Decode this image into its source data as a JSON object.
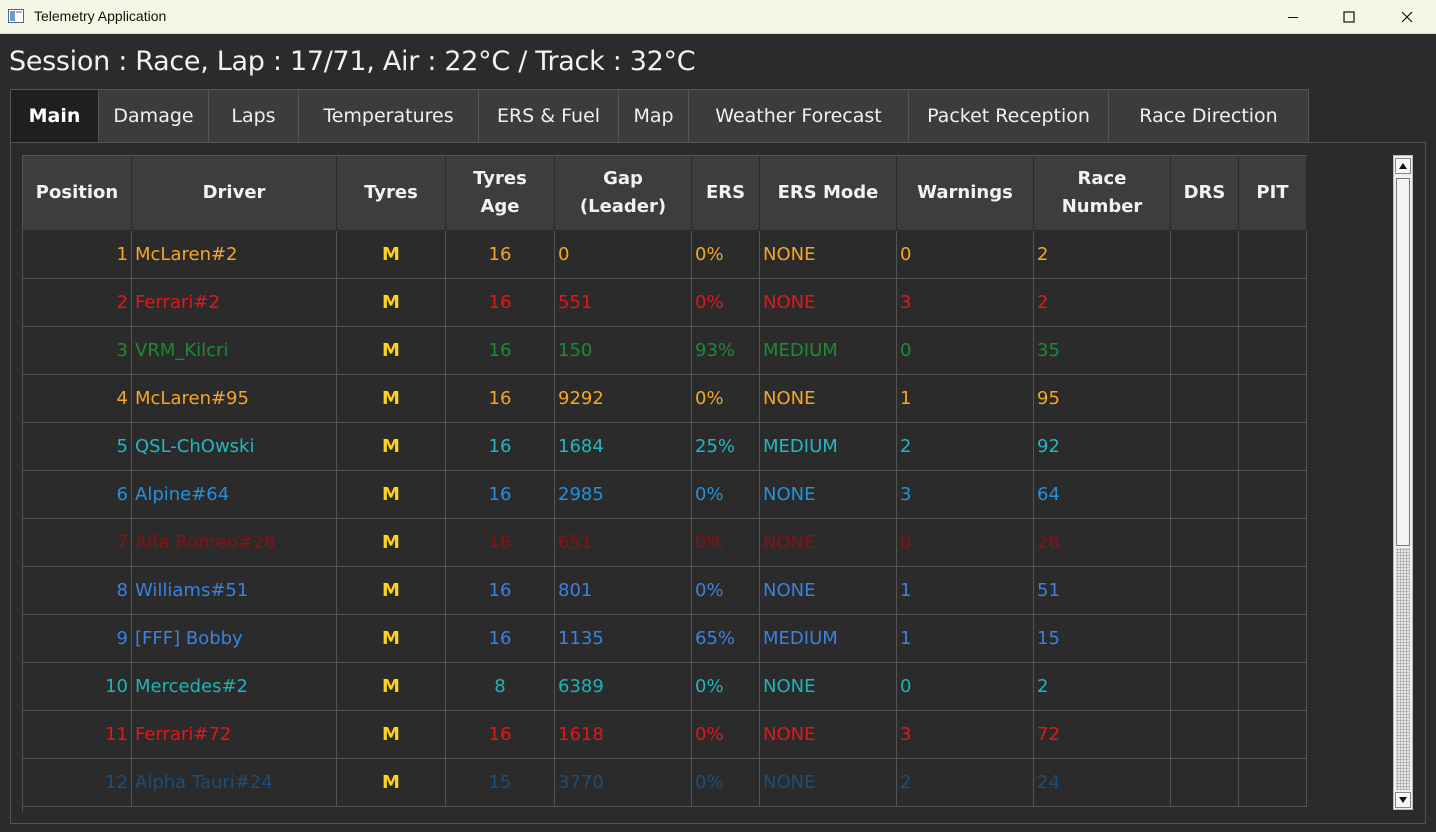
{
  "window": {
    "title": "Telemetry Application"
  },
  "session_text": "Session : Race, Lap : 17/71, Air : 22°C / Track : 32°C",
  "tabs": [
    {
      "label": "Main",
      "active": true
    },
    {
      "label": "Damage",
      "active": false
    },
    {
      "label": "Laps",
      "active": false
    },
    {
      "label": "Temperatures",
      "active": false
    },
    {
      "label": "ERS & Fuel",
      "active": false
    },
    {
      "label": "Map",
      "active": false
    },
    {
      "label": "Weather Forecast",
      "active": false
    },
    {
      "label": "Packet Reception",
      "active": false
    },
    {
      "label": "Race Direction",
      "active": false
    }
  ],
  "table": {
    "columns": [
      "Position",
      "Driver",
      "Tyres",
      "Tyres\nAge",
      "Gap\n(Leader)",
      "ERS",
      "ERS Mode",
      "Warnings",
      "Race\nNumber",
      "DRS",
      "PIT"
    ],
    "rows": [
      {
        "position": "1",
        "driver": "McLaren#2",
        "tyres": "M",
        "tyres_age": "16",
        "gap": "0",
        "ers": "0%",
        "ers_mode": "NONE",
        "warnings": "0",
        "race_number": "2",
        "drs": "",
        "pit": "",
        "color": "#f5a623"
      },
      {
        "position": "2",
        "driver": "Ferrari#2",
        "tyres": "M",
        "tyres_age": "16",
        "gap": "551",
        "ers": "0%",
        "ers_mode": "NONE",
        "warnings": "3",
        "race_number": "2",
        "drs": "",
        "pit": "",
        "color": "#e3161b"
      },
      {
        "position": "3",
        "driver": "VRM_Kilcri",
        "tyres": "M",
        "tyres_age": "16",
        "gap": "150",
        "ers": "93%",
        "ers_mode": "MEDIUM",
        "warnings": "0",
        "race_number": "35",
        "drs": "",
        "pit": "",
        "color": "#1e8a35"
      },
      {
        "position": "4",
        "driver": "McLaren#95",
        "tyres": "M",
        "tyres_age": "16",
        "gap": "9292",
        "ers": "0%",
        "ers_mode": "NONE",
        "warnings": "1",
        "race_number": "95",
        "drs": "",
        "pit": "",
        "color": "#f5a623"
      },
      {
        "position": "5",
        "driver": "QSL-ChOwski",
        "tyres": "M",
        "tyres_age": "16",
        "gap": "1684",
        "ers": "25%",
        "ers_mode": "MEDIUM",
        "warnings": "2",
        "race_number": "92",
        "drs": "",
        "pit": "",
        "color": "#22b8c2"
      },
      {
        "position": "6",
        "driver": "Alpine#64",
        "tyres": "M",
        "tyres_age": "16",
        "gap": "2985",
        "ers": "0%",
        "ers_mode": "NONE",
        "warnings": "3",
        "race_number": "64",
        "drs": "",
        "pit": "",
        "color": "#2192e0"
      },
      {
        "position": "7",
        "driver": "Alfa Romeo#26",
        "tyres": "M",
        "tyres_age": "16",
        "gap": "651",
        "ers": "0%",
        "ers_mode": "NONE",
        "warnings": "0",
        "race_number": "26",
        "drs": "",
        "pit": "",
        "color": "#8c1010"
      },
      {
        "position": "8",
        "driver": "Williams#51",
        "tyres": "M",
        "tyres_age": "16",
        "gap": "801",
        "ers": "0%",
        "ers_mode": "NONE",
        "warnings": "1",
        "race_number": "51",
        "drs": "",
        "pit": "",
        "color": "#3b82e0"
      },
      {
        "position": "9",
        "driver": "[FFF] Bobby",
        "tyres": "M",
        "tyres_age": "16",
        "gap": "1135",
        "ers": "65%",
        "ers_mode": "MEDIUM",
        "warnings": "1",
        "race_number": "15",
        "drs": "",
        "pit": "",
        "color": "#3b82e0"
      },
      {
        "position": "10",
        "driver": "Mercedes#2",
        "tyres": "M",
        "tyres_age": "8",
        "gap": "6389",
        "ers": "0%",
        "ers_mode": "NONE",
        "warnings": "0",
        "race_number": "2",
        "drs": "",
        "pit": "",
        "color": "#1fb5b8"
      },
      {
        "position": "11",
        "driver": "Ferrari#72",
        "tyres": "M",
        "tyres_age": "16",
        "gap": "1618",
        "ers": "0%",
        "ers_mode": "NONE",
        "warnings": "3",
        "race_number": "72",
        "drs": "",
        "pit": "",
        "color": "#e3161b"
      },
      {
        "position": "12",
        "driver": "Alpha Tauri#24",
        "tyres": "M",
        "tyres_age": "15",
        "gap": "3770",
        "ers": "0%",
        "ers_mode": "NONE",
        "warnings": "2",
        "race_number": "24",
        "drs": "",
        "pit": "",
        "color": "#1c4e78"
      }
    ]
  },
  "icons": {
    "app": "app-window-icon",
    "minimize": "minimize-icon",
    "maximize": "maximize-icon",
    "close": "close-icon",
    "scroll_up": "arrow-up-icon",
    "scroll_down": "arrow-down-icon"
  }
}
